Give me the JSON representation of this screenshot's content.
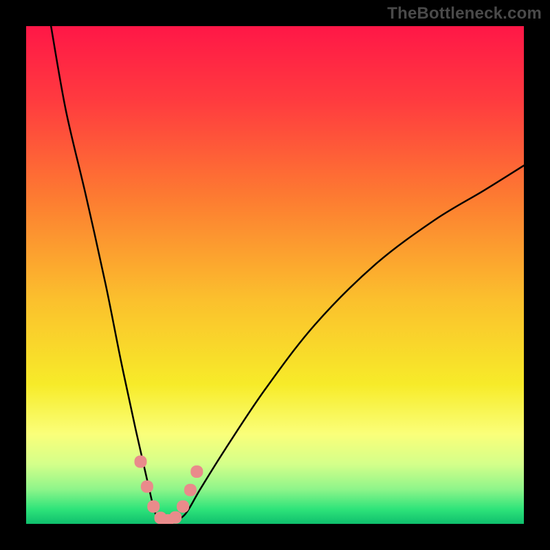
{
  "watermark": {
    "text": "TheBottleneck.com"
  },
  "chart_data": {
    "type": "line",
    "title": "",
    "xlabel": "",
    "ylabel": "",
    "xlim": [
      0,
      100
    ],
    "ylim": [
      0,
      100
    ],
    "background_gradient": {
      "stops": [
        {
          "offset": 0.0,
          "color": "#ff1747"
        },
        {
          "offset": 0.15,
          "color": "#ff3b3f"
        },
        {
          "offset": 0.35,
          "color": "#fd7d31"
        },
        {
          "offset": 0.55,
          "color": "#fbc02d"
        },
        {
          "offset": 0.72,
          "color": "#f7eb29"
        },
        {
          "offset": 0.82,
          "color": "#faff7a"
        },
        {
          "offset": 0.88,
          "color": "#d4ff8a"
        },
        {
          "offset": 0.93,
          "color": "#8ff58a"
        },
        {
          "offset": 0.97,
          "color": "#2fe47a"
        },
        {
          "offset": 1.0,
          "color": "#0fbf6d"
        }
      ]
    },
    "series": [
      {
        "name": "bottleneck-curve",
        "x": [
          5,
          8,
          12,
          16,
          19,
          22,
          24.5,
          26,
          27.5,
          29.5,
          32,
          35,
          40,
          48,
          58,
          70,
          82,
          92,
          100
        ],
        "y": [
          100,
          83,
          66,
          48,
          33,
          19,
          8,
          2,
          0.5,
          0.5,
          2,
          7,
          15,
          27,
          40,
          52,
          61,
          67,
          72
        ]
      }
    ],
    "markers": {
      "name": "highlight-dots",
      "color": "#e98b8b",
      "points": [
        {
          "x": 23.0,
          "y": 12.5
        },
        {
          "x": 24.3,
          "y": 7.5
        },
        {
          "x": 25.6,
          "y": 3.5
        },
        {
          "x": 27.0,
          "y": 1.2
        },
        {
          "x": 28.5,
          "y": 0.7
        },
        {
          "x": 30.0,
          "y": 1.3
        },
        {
          "x": 31.5,
          "y": 3.5
        },
        {
          "x": 33.0,
          "y": 6.8
        },
        {
          "x": 34.3,
          "y": 10.5
        }
      ]
    }
  }
}
